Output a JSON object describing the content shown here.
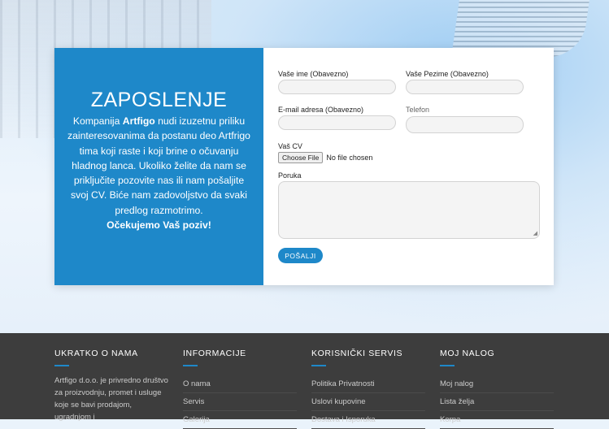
{
  "hero": {
    "title": "ZAPOSLENJE",
    "intro_part1": "Kompanija ",
    "intro_brand": "Artfigo",
    "intro_part2": " nudi izuzetnu priliku zainteresovanima da postanu deo Artfrigo tima koji raste i koji brine o očuvanju hladnog lanca. Ukoliko želite da nam se priključite pozovite nas ili nam pošaljite svoj CV. Biće nam zadovoljstvo da svaki predlog razmotrimo.",
    "closing": "Očekujemo Vaš poziv!"
  },
  "form": {
    "first_name_label": "Vaše ime (Obavezno)",
    "last_name_label": "Vaše Pezime (Obavezno)",
    "email_label": "E-mail adresa (Obavezno)",
    "phone_label": "Telefon",
    "cv_label": "Vaš CV",
    "file_button": "Choose File",
    "file_status": "No file chosen",
    "message_label": "Poruka",
    "submit_label": "POŠALJI"
  },
  "footer": {
    "columns": [
      {
        "title": "UKRATKO O NAMA",
        "text": "Artfigo d.o.o. je privredno društvo za proizvodnju, promet i usluge koje se bavi prodajom, ugradnjom i"
      },
      {
        "title": "INFORMACIJE",
        "links": [
          "O nama",
          "Servis",
          "Galerija"
        ]
      },
      {
        "title": "KORISNIČKI SERVIS",
        "links": [
          "Politika Privatnosti",
          "Uslovi kupovine",
          "Dostava i Isporuka"
        ]
      },
      {
        "title": "MOJ NALOG",
        "links": [
          "Moj nalog",
          "Lista želja",
          "Korpa"
        ]
      }
    ]
  },
  "colors": {
    "accent": "#1e88c9",
    "footer_bg": "#3d3d3d"
  }
}
